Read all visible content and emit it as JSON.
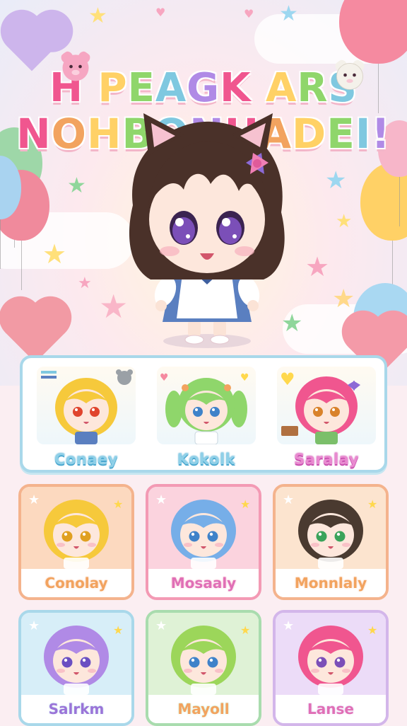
{
  "title": {
    "line1": "H PEAGK ARS",
    "line2": "NOHBONHADEI!"
  },
  "featured_character": {
    "hair_color": "#4a3129",
    "eye_color": "#7b4fb8",
    "outfit": "apron"
  },
  "top_panel": {
    "border_color": "#a9d8ea",
    "characters": [
      {
        "name": "Conaey",
        "hair": "#f6c93b",
        "eyes": "#e0452e",
        "text_color": "#7fc8e0",
        "name_stroke": "#5db5d6"
      },
      {
        "name": "Kokolk",
        "hair": "#8fd66b",
        "eyes": "#3f82c9",
        "text_color": "#7fc8e0",
        "name_stroke": "#5db5d6"
      },
      {
        "name": "Saralay",
        "hair": "#f0568f",
        "eyes": "#d9822b",
        "text_color": "#e070c0",
        "name_stroke": "#cf4fb1"
      }
    ]
  },
  "cards": [
    {
      "name": "Conolay",
      "hair": "#f6c93b",
      "eyes": "#e0a020",
      "border": "#f4b38d",
      "bg": "#fcd9bf",
      "text": "#f2a35f"
    },
    {
      "name": "Mosaaly",
      "hair": "#76aee8",
      "eyes": "#3f82c9",
      "border": "#f39ab4",
      "bg": "#fbd3de",
      "text": "#e06fb6"
    },
    {
      "name": "Monnlaly",
      "hair": "#4a3a30",
      "eyes": "#3aa35a",
      "border": "#f4b38d",
      "bg": "#fce4cf",
      "text": "#f2a35f"
    },
    {
      "name": "Salrkm",
      "hair": "#b08ae6",
      "eyes": "#6a4fc2",
      "border": "#a9d8ea",
      "bg": "#d7eef8",
      "text": "#9a74d8"
    },
    {
      "name": "Mayoll",
      "hair": "#9cd65a",
      "eyes": "#3f82c9",
      "border": "#a9dcae",
      "bg": "#dff2d6",
      "text": "#f2a35f"
    },
    {
      "name": "Lanse",
      "hair": "#f0568f",
      "eyes": "#7b4fb8",
      "border": "#d3b6ea",
      "bg": "#ecdcf8",
      "text": "#e06fb6"
    }
  ],
  "palette": {
    "accent_pink": "#f39ab4",
    "accent_blue": "#a9d8ea",
    "star_yellow": "#ffd84d"
  },
  "icons": [
    "heart-balloon-icon",
    "star-icon",
    "heart-icon",
    "bear-mascot-icon",
    "bow-icon"
  ]
}
